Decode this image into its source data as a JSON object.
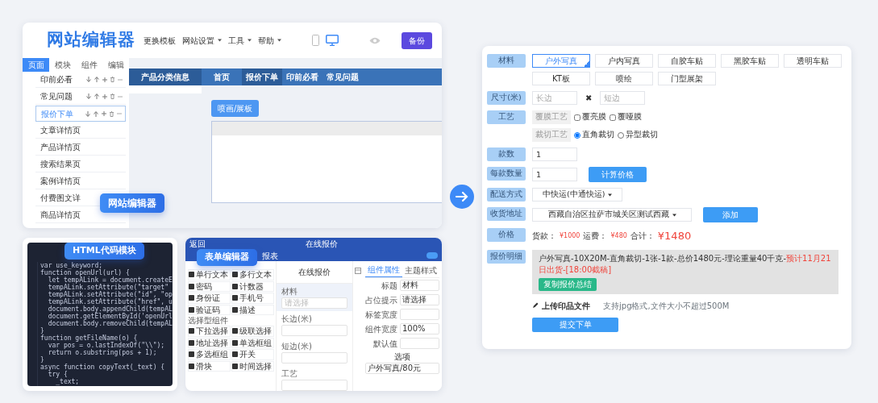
{
  "editor": {
    "logo": "网站编辑器",
    "menu": [
      {
        "label": "更换模板",
        "dropdown": false
      },
      {
        "label": "网站设置",
        "dropdown": true
      },
      {
        "label": "工具",
        "dropdown": true
      },
      {
        "label": "帮助",
        "dropdown": true
      }
    ],
    "devices": [
      {
        "kind": "mobile",
        "selected": false
      },
      {
        "kind": "desktop",
        "selected": true
      }
    ],
    "backup_button": "备份",
    "tabs": [
      {
        "label": "页面",
        "selected": true
      },
      {
        "label": "模块",
        "selected": false
      },
      {
        "label": "组件",
        "selected": false
      },
      {
        "label": "编辑",
        "selected": false
      }
    ],
    "pages": [
      {
        "label": "印前必看",
        "actions": true,
        "selected": false
      },
      {
        "label": "常见问题",
        "actions": true,
        "selected": false
      },
      {
        "label": "报价下单",
        "actions": true,
        "selected": true
      },
      {
        "label": "文章详情页",
        "actions": false,
        "selected": false
      },
      {
        "label": "产品详情页",
        "actions": false,
        "selected": false
      },
      {
        "label": "搜索结果页",
        "actions": false,
        "selected": false
      },
      {
        "label": "案例详情页",
        "actions": false,
        "selected": false
      },
      {
        "label": "付费图文详",
        "actions": false,
        "selected": false
      },
      {
        "label": "商品详情页",
        "actions": false,
        "selected": false
      }
    ],
    "category": "产品分类信息",
    "site_nav": [
      {
        "label": "首页",
        "selected": false
      },
      {
        "label": "报价下单",
        "selected": true
      },
      {
        "label": "印前必看",
        "selected": false
      },
      {
        "label": "常见问题",
        "selected": false
      }
    ],
    "tooltip": "喷画/展板",
    "badge": "网站编辑器"
  },
  "code_panel": {
    "badge": "HTML代码模块",
    "lines": [
      "var use_keyword;",
      "function openUrl(url) {",
      "  let tempALink = document.createE",
      "  tempALink.setAttribute(\"target\"",
      "  tempALink.setAttribute(\"id\", \"op",
      "  tempALink.setAttribute(\"href\", u",
      "  document.body.appendChild(tempAL",
      "  document.getElementById('openUrl",
      "  document.body.removeChild(tempAL",
      "}",
      "function getFileName(o) {",
      "  var pos = o.lastIndexOf(\"\\\\\");",
      "  return o.substring(pos + 1);",
      "}",
      "async function copyText(_text) {",
      "  try {",
      "    _text;"
    ]
  },
  "form_editor": {
    "back": "返回",
    "title": "在线报价",
    "menu_item": "报表",
    "badge": "表单编辑器",
    "palette": [
      {
        "items": [
          "单行文本",
          "多行文本",
          "密码",
          "计数器",
          "身份证",
          "手机号",
          "验证码",
          "描述"
        ]
      },
      {
        "header": "选择型组件",
        "items": [
          "下拉选择",
          "级联选择",
          "地址选择",
          "单选框组",
          "多选框组",
          "开关",
          "滑块",
          "时间选择"
        ]
      }
    ],
    "form_title": "在线报价",
    "fields": [
      {
        "label": "材料",
        "placeholder": "请选择",
        "selected": true
      },
      {
        "label": "长边(米)",
        "selected": false
      },
      {
        "label": "短边(米)",
        "selected": false
      },
      {
        "label": "工艺",
        "selected": false
      }
    ],
    "prop_tabs": [
      {
        "label": "组件属性",
        "selected": true
      },
      {
        "label": "主题样式",
        "selected": false
      }
    ],
    "props": [
      {
        "label": "标题",
        "value": "材料"
      },
      {
        "label": "占位提示",
        "value": "请选择"
      },
      {
        "label": "标签宽度"
      },
      {
        "label": "组件宽度",
        "value": "100%"
      },
      {
        "label": "默认值"
      }
    ],
    "options_title": "选项",
    "option": "户外写真/80元"
  },
  "quote_form": {
    "material": {
      "label": "材料",
      "options": [
        {
          "label": "户外写真",
          "selected": true
        },
        {
          "label": "户内写真",
          "selected": false
        },
        {
          "label": "自胶车贴",
          "selected": false
        },
        {
          "label": "黑胶车贴",
          "selected": false
        },
        {
          "label": "透明车贴",
          "selected": false
        },
        {
          "label": "KT板",
          "selected": false
        },
        {
          "label": "喷绘",
          "selected": false
        },
        {
          "label": "门型展架",
          "selected": false
        }
      ]
    },
    "size": {
      "label": "尺寸(米)",
      "long_placeholder": "长边",
      "times": "✖",
      "short_placeholder": "短边"
    },
    "craft": {
      "label": "工艺",
      "groups": [
        {
          "label": "覆膜工艺",
          "kind": "checkbox",
          "options": [
            {
              "label": "覆亮膜",
              "checked": false
            },
            {
              "label": "覆哑膜",
              "checked": false
            }
          ]
        },
        {
          "label": "裁切工艺",
          "kind": "radio",
          "options": [
            {
              "label": "直角裁切",
              "selected": true
            },
            {
              "label": "异型裁切",
              "selected": false
            }
          ]
        }
      ]
    },
    "styles": {
      "label": "款数",
      "value": "1"
    },
    "per_style": {
      "label": "每款数量",
      "value": "1",
      "button": "计算价格"
    },
    "shipping": {
      "label": "配送方式",
      "value": "中快运(中通快运)"
    },
    "address": {
      "label": "收货地址",
      "value": "西藏自治区拉萨市城关区测试西藏",
      "button": "添加"
    },
    "price": {
      "label": "价格",
      "goods_label": "货款：",
      "goods": "¥1000",
      "freight_label": "运费：",
      "freight": "¥480",
      "total_label": "合计：",
      "total": "¥1480"
    },
    "detail": {
      "label": "报价明细",
      "summary": "户外写真-10X20M-直角裁切-1张-1款-总价1480元-理论重量40千克-",
      "eta": "预计11月21日出货-[18:00截稿]",
      "copy_button": "复制报价总结"
    },
    "upload": {
      "label": "上传印品文件",
      "hint": "支持jpg格式,文件大小不超过500M"
    },
    "submit": "提交下单"
  }
}
